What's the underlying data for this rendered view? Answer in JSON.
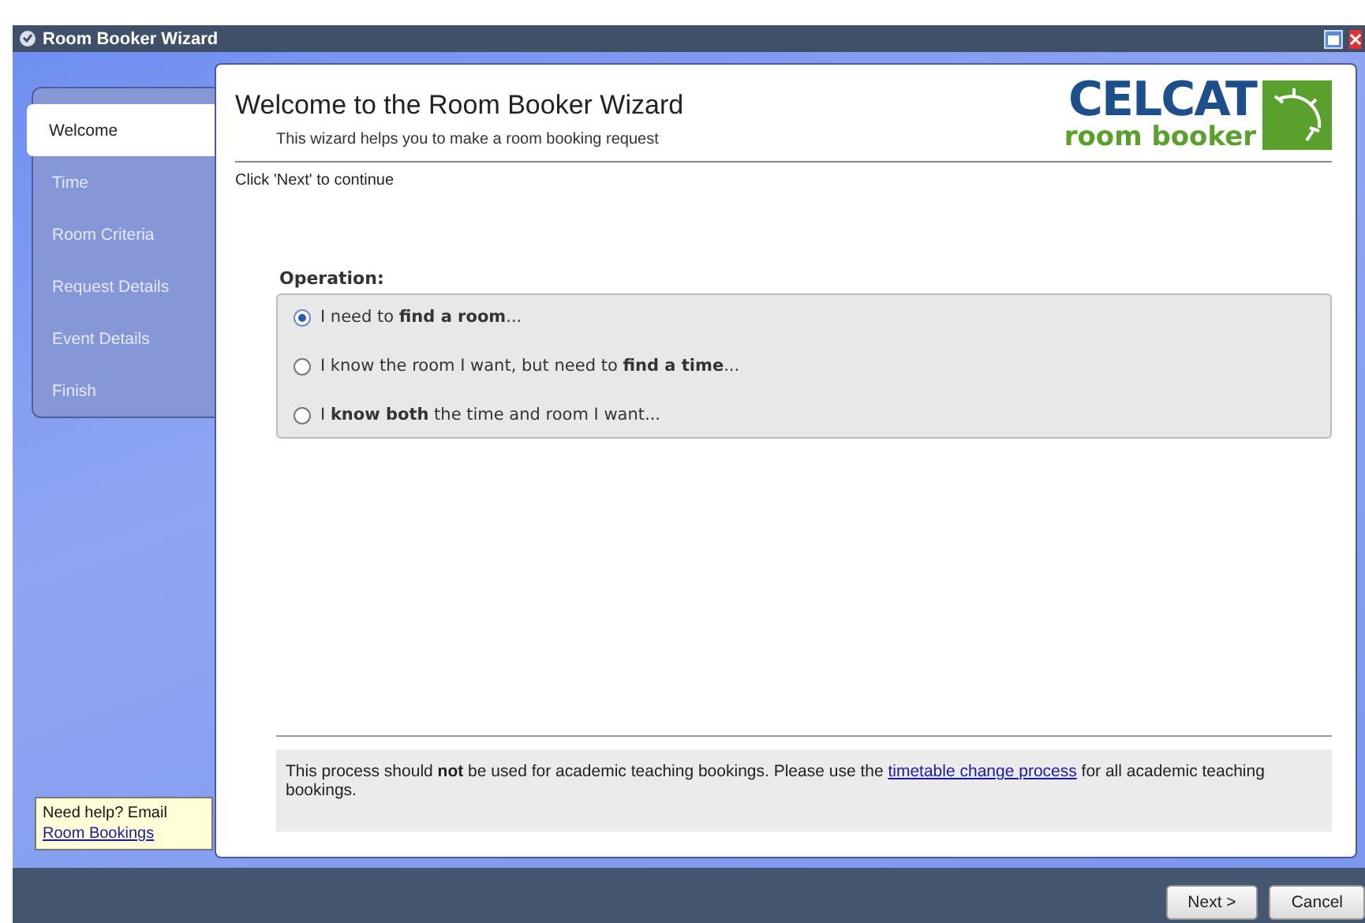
{
  "window": {
    "title": "Room Booker Wizard"
  },
  "steps": [
    {
      "label": "Welcome",
      "selected": true
    },
    {
      "label": "Time",
      "selected": false
    },
    {
      "label": "Room Criteria",
      "selected": false
    },
    {
      "label": "Request Details",
      "selected": false
    },
    {
      "label": "Event Details",
      "selected": false
    },
    {
      "label": "Finish",
      "selected": false
    }
  ],
  "help": {
    "text": "Need help? Email",
    "link": "Room Bookings"
  },
  "header": {
    "title": "Welcome to the Room Booker Wizard",
    "subtitle": "This wizard helps you to make a room booking request"
  },
  "logo": {
    "brand": "CELCAT",
    "product": "room booker"
  },
  "instruction": "Click 'Next' to continue",
  "operation": {
    "label": "Operation:",
    "options": [
      {
        "text": "I need to **find a room**...",
        "selected": true
      },
      {
        "text": "I know the room I want, but need to **find a time**...",
        "selected": false
      },
      {
        "text": "I **know both** the time and room I want...",
        "selected": false
      }
    ]
  },
  "notice": {
    "before": "This process should **not** be used for academic teaching bookings. Please use the",
    "link": "timetable change process",
    "after": "for all academic teaching bookings."
  },
  "buttons": [
    {
      "label": "Next >"
    },
    {
      "label": "Cancel"
    }
  ]
}
